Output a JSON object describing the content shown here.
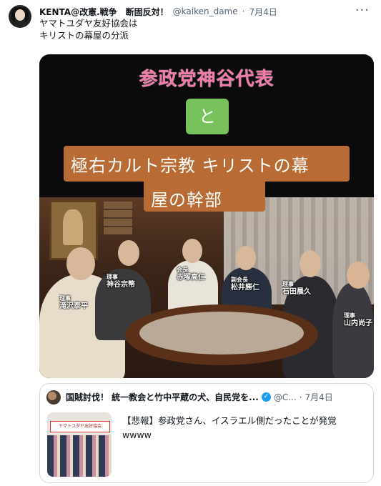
{
  "tweet": {
    "name": "KENTA@改憲.戦争　断固反対！",
    "handle": "@kaiken_dame",
    "dot": "·",
    "date": "7月4日",
    "more_icon": "···",
    "text": "ヤマトユダヤ友好協会は\nキリストの幕屋の分派"
  },
  "media": {
    "title": "参政党神谷代表",
    "connector": "と",
    "line1": "極右カルト宗教 キリストの幕",
    "line2": "屋の幹部",
    "people": [
      {
        "role": "理事",
        "name": "滝沢泰平"
      },
      {
        "role": "理事",
        "name": "神谷宗幣"
      },
      {
        "role": "会長",
        "name": "赤塚高仁"
      },
      {
        "role": "副会長",
        "name": "松井勝仁"
      },
      {
        "role": "理事",
        "name": "石田晨久"
      },
      {
        "role": "理事",
        "name": "山内尚子"
      }
    ]
  },
  "quote": {
    "name": "国賊討伐！ 統一教会と竹中平蔵の犬、自民党を...",
    "verified_icon": "✓",
    "handle": "@C...",
    "dot": "·",
    "date": "7月4日",
    "text": "【悲報】参政党さん、イスラエル側だったことが発覚wwww",
    "thumb_banner": "ヤマトユダヤ友好協会"
  },
  "colors": {
    "title_pink": "#f07aa8",
    "connector_green": "#77c25c",
    "banner_brown": "#b86b34",
    "verified_blue": "#1d9bf0"
  }
}
